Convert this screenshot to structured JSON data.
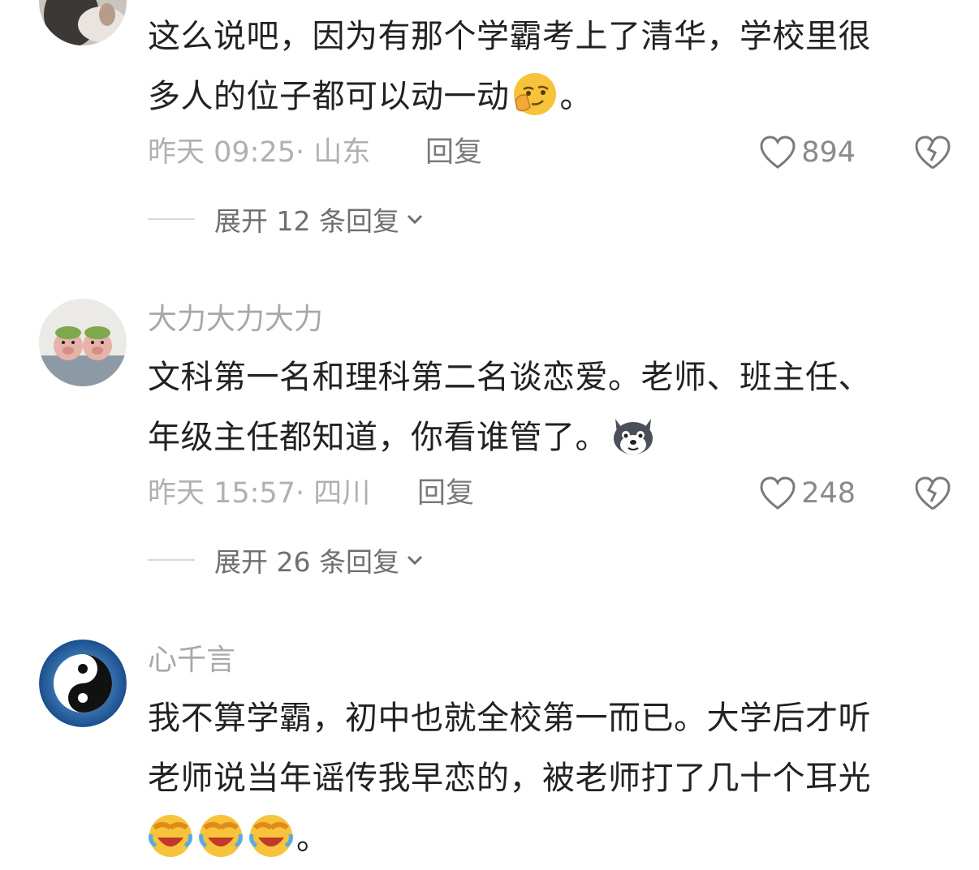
{
  "comments": [
    {
      "username": "",
      "lines": [
        "这么说吧，因为有那个学霸考上了清华，学校里很",
        "多人的位子都可以动一动"
      ],
      "line2_after_emoji": "。",
      "emoji": "thinking-smirk-emoji",
      "time_location": "昨天 09:25· 山东",
      "reply_label": "回复",
      "likes": "894",
      "expand_label": "展开 12 条回复"
    },
    {
      "username": "大力大力大力",
      "lines": [
        "文科第一名和理科第二名谈恋爱。老师、班主任、",
        "年级主任都知道，你看谁管了。"
      ],
      "emoji": "husky-dog-emoji",
      "time_location": "昨天 15:57· 四川",
      "reply_label": "回复",
      "likes": "248",
      "expand_label": "展开 26 条回复"
    },
    {
      "username": "心千言",
      "lines": [
        "我不算学霸，初中也就全校第一而已。大学后才听",
        "老师说当年谣传我早恋的，被老师打了几十个耳光"
      ],
      "line3_tail": "。",
      "emoji": "crying-laughing-emoji"
    }
  ],
  "colors": {
    "username": "#a8a8a8",
    "text": "#222222",
    "meta": "#b0b0b0",
    "reply": "#7a7a7a",
    "expand": "#6f6f6f"
  }
}
